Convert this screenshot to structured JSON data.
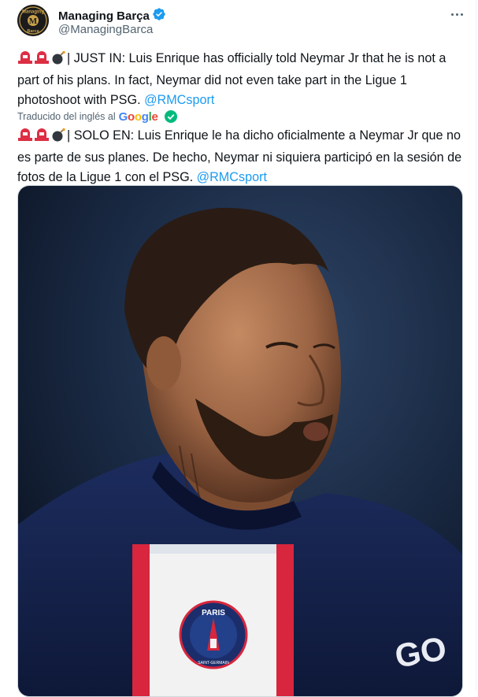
{
  "author": {
    "display_name": "Managing Barça",
    "handle": "@ManagingBarca",
    "avatar_text_top": "Managing",
    "avatar_text_bottom": "Barca",
    "avatar_monogram": "M"
  },
  "tweet": {
    "original_text": "| JUST IN: Luis Enrique has officially told Neymar Jr that he is not a part of his plans. In fact, Neymar did not even take part in the Ligue 1 photoshoot with PSG.",
    "original_mention": "@RMCsport",
    "translated_label": "Traducido del inglés al",
    "translator_brand": "Google",
    "translated_text": "| SOLO EN: Luis Enrique le ha dicho oficialmente a Neymar Jr que no es parte de sus planes. De hecho, Neymar ni siquiera participó en la sesión de fotos de la Ligue 1 con el PSG.",
    "translated_mention": "@RMCsport"
  },
  "media": {
    "crest_text": "PARIS",
    "crest_subtext": "SAINT-GERMAIN",
    "sponsor_text": "GO"
  },
  "icons": [
    "verified-badge-icon",
    "more-options-icon",
    "siren-emoji",
    "bomb-emoji",
    "check-circle-icon"
  ],
  "colors": {
    "link": "#1d9bf0",
    "verified": "#1d9bf0",
    "secondary": "#536471",
    "check": "#00ba7c"
  }
}
